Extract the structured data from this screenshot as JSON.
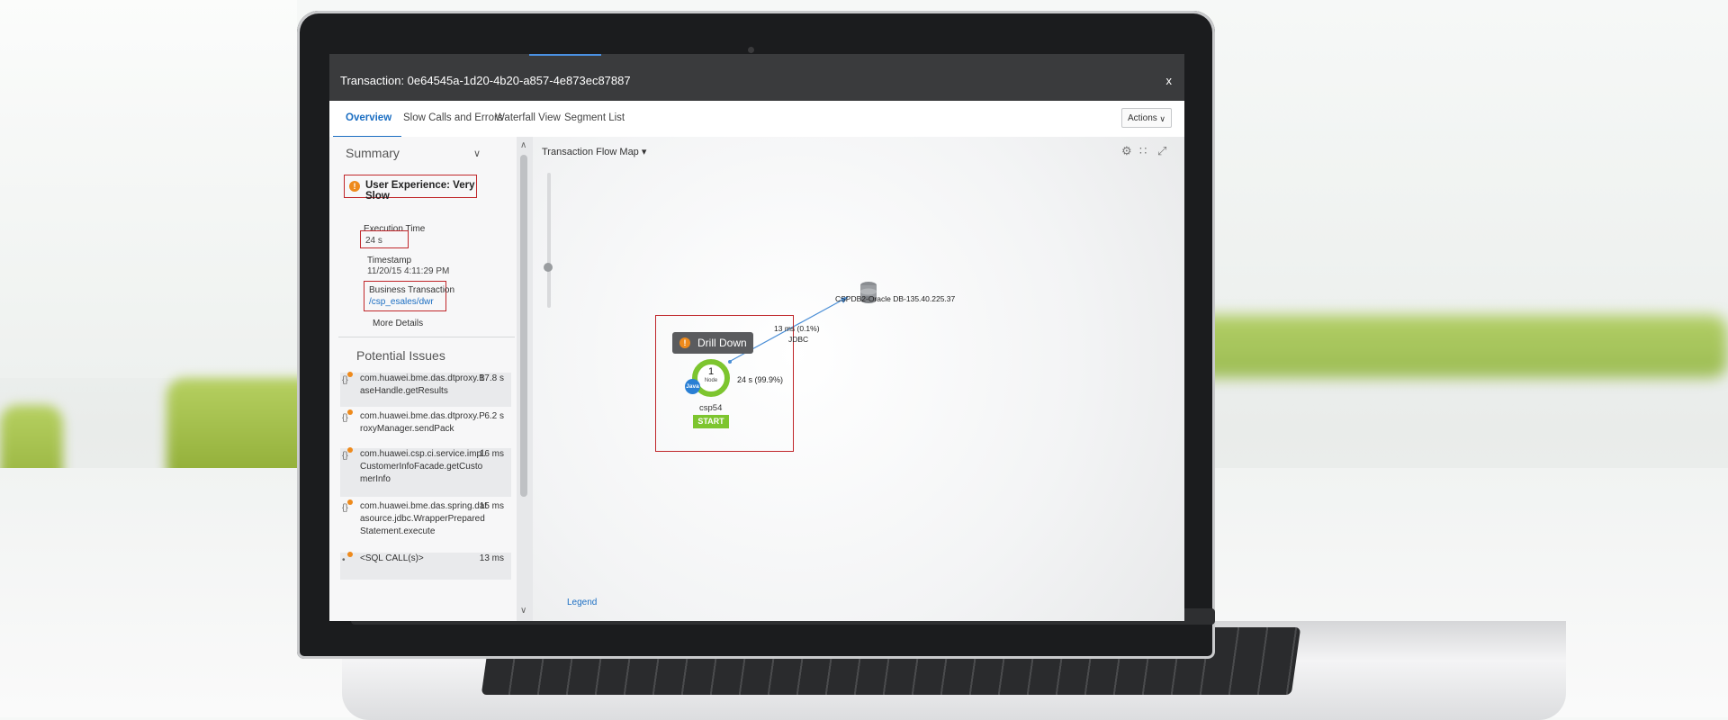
{
  "window": {
    "title": "Transaction: 0e64545a-1d20-4b20-a857-4e873ec87887",
    "close_label": "x"
  },
  "tabs": [
    {
      "label": "Overview",
      "active": true
    },
    {
      "label": "Slow Calls and Errors"
    },
    {
      "label": "Waterfall View"
    },
    {
      "label": "Segment List"
    }
  ],
  "actions_label": "Actions",
  "summary": {
    "heading": "Summary",
    "user_experience": "User Experience: Very Slow",
    "execution_time_label": "Execution Time",
    "execution_time": "24 s",
    "timestamp_label": "Timestamp",
    "timestamp": "11/20/15 4:11:29 PM",
    "business_transaction_label": "Business Transaction",
    "business_transaction": "/csp_esales/dwr",
    "more_details": "More Details"
  },
  "potential_issues": {
    "heading": "Potential Issues",
    "items": [
      {
        "name": "com.huawei.bme.das.dtproxy.BaseHandle.getResults",
        "line1": "com.huawei.bme.das.dtproxy.B",
        "line2": "aseHandle.getResults",
        "duration": "17.8 s"
      },
      {
        "name": "com.huawei.bme.das.dtproxy.ProxyManager.sendPack",
        "line1": "com.huawei.bme.das.dtproxy.P",
        "line2": "roxyManager.sendPack",
        "duration": "6.2 s"
      },
      {
        "name": "com.huawei.csp.ci.service.impl.CustomerInfoFacade.getCustomerInfo",
        "line1": "com.huawei.csp.ci.service.impl.",
        "line2": "CustomerInfoFacade.getCusto",
        "line3": "merInfo",
        "duration": "16 ms"
      },
      {
        "name": "com.huawei.bme.das.spring.datasource.jdbc.WrapperPreparedStatement.execute",
        "line1": "com.huawei.bme.das.spring.dat",
        "line2": "asource.jdbc.WrapperPrepared",
        "line3": "Statement.execute",
        "duration": "15 ms"
      },
      {
        "name": "<SQL CALL(s)>",
        "line1": "<SQL CALL(s)>",
        "duration": "13 ms"
      }
    ]
  },
  "flow_map": {
    "label": "Transaction Flow Map ▾",
    "legend": "Legend",
    "tools": [
      "settings-icon",
      "layout-icon",
      "fullscreen-icon"
    ],
    "node": {
      "drill_down": "Drill Down",
      "count": "1",
      "count_label": "Node",
      "platform": "Java",
      "name": "csp54",
      "start_label": "START",
      "time": "24 s (99.9%)"
    },
    "edge": {
      "time": "13 ms (0.1%)",
      "protocol": "JDBC"
    },
    "database": {
      "label": "CSPDB2-Oracle DB-135.40.225.37"
    }
  },
  "colors": {
    "accent": "#1b6ec2",
    "highlight": "#c0262a",
    "warning": "#ee8a1c",
    "ok": "#7dc52f"
  }
}
